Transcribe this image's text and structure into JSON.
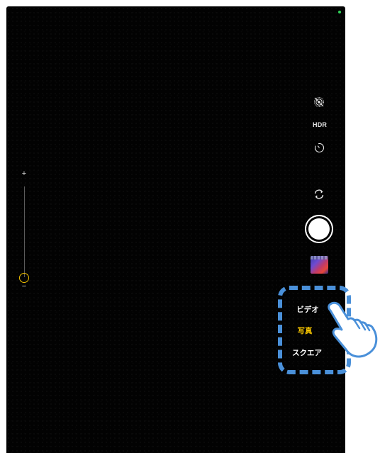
{
  "camera": {
    "zoom": {
      "plus": "+",
      "minus": "−",
      "level": 0.0
    },
    "controls": {
      "live_photo_icon": "live-photo-off-icon",
      "hdr_label": "HDR",
      "timer_icon": "timer-icon",
      "flip_icon": "camera-flip-icon",
      "shutter_icon": "shutter-button",
      "thumbnail_icon": "last-photo-thumbnail"
    },
    "modes": [
      {
        "label": "ビデオ",
        "selected": false
      },
      {
        "label": "写真",
        "selected": true
      },
      {
        "label": "スクエア",
        "selected": false
      }
    ],
    "colors": {
      "selected_mode": "#f5c400",
      "highlight": "#4a90d9",
      "background": "#020202"
    }
  }
}
